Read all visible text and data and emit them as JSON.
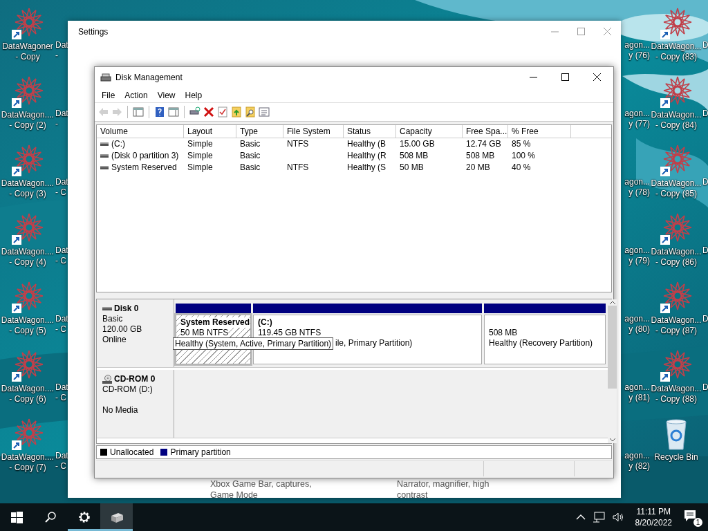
{
  "desktop": {
    "columns": [
      {
        "kind": "full",
        "items": [
          {
            "kind": "shortcut",
            "label": "DataWagoner",
            "sublabel": "- Copy"
          },
          {
            "kind": "shortcut",
            "label": "DataWagon....",
            "sublabel": "- Copy (2)"
          },
          {
            "kind": "shortcut",
            "label": "DataWagon....",
            "sublabel": "- Copy (3)"
          },
          {
            "kind": "shortcut",
            "label": "DataWagon....",
            "sublabel": "- Copy (4)"
          },
          {
            "kind": "shortcut",
            "label": "DataWagon....",
            "sublabel": "- Copy (5)"
          },
          {
            "kind": "shortcut",
            "label": "DataWagon....",
            "sublabel": "- Copy (6)"
          },
          {
            "kind": "shortcut",
            "label": "DataWagon....",
            "sublabel": "- Copy (7)"
          }
        ]
      },
      {
        "kind": "clip-left",
        "items": [
          {
            "label": "Dat",
            "sublabel": "-"
          },
          {
            "label": "Dat",
            "sublabel": "-"
          },
          {
            "label": "Dat",
            "sublabel": "- C"
          },
          {
            "label": "Dat",
            "sublabel": "- C"
          },
          {
            "label": "Dat",
            "sublabel": "- C"
          },
          {
            "label": "Dat",
            "sublabel": "- C"
          },
          {
            "label": "Dat",
            "sublabel": "- C"
          }
        ]
      },
      {
        "kind": "clip-right",
        "items": [
          {
            "label": "agon...",
            "sublabel": "y (76)"
          },
          {
            "label": "agon...",
            "sublabel": "y (77)"
          },
          {
            "label": "agon...",
            "sublabel": "y (78)"
          },
          {
            "label": "agon...",
            "sublabel": "y (79)"
          },
          {
            "label": "agon...",
            "sublabel": "y (80)"
          },
          {
            "label": "agon...",
            "sublabel": "y (81)"
          },
          {
            "label": "agon...",
            "sublabel": "y (82)"
          }
        ]
      },
      {
        "kind": "full",
        "items": [
          {
            "kind": "shortcut",
            "label": "DataWagon...",
            "sublabel": "- Copy (83)"
          },
          {
            "kind": "shortcut",
            "label": "DataWagon...",
            "sublabel": "- Copy (84)"
          },
          {
            "kind": "shortcut",
            "label": "DataWagon...",
            "sublabel": "- Copy (85)"
          },
          {
            "kind": "shortcut",
            "label": "DataWagon...",
            "sublabel": "- Copy (86)"
          },
          {
            "kind": "shortcut",
            "label": "DataWagon...",
            "sublabel": "- Copy (87)"
          },
          {
            "kind": "shortcut",
            "label": "DataWagon...",
            "sublabel": "- Copy (88)"
          },
          {
            "kind": "recycle-bin",
            "label": "Recycle Bin"
          }
        ]
      },
      {
        "kind": "clip-left",
        "items": [
          {
            "label": "D"
          },
          {
            "label": "D"
          },
          {
            "label": "D"
          },
          {
            "label": "D"
          },
          {
            "label": "D"
          },
          {
            "label": "D"
          }
        ]
      }
    ]
  },
  "settings_window": {
    "title": "Settings",
    "items": [
      {
        "text": "Xbox Game Bar, captures, Game Mode"
      },
      {
        "text": "Narrator, magnifier, high contrast"
      }
    ]
  },
  "disk_management": {
    "title": "Disk Management",
    "menu": [
      "File",
      "Action",
      "View",
      "Help"
    ],
    "toolbar": [
      {
        "kind": "back",
        "disabled": true
      },
      {
        "kind": "forward",
        "disabled": true
      },
      {
        "kind": "separator"
      },
      {
        "kind": "console-tree",
        "disabled": false
      },
      {
        "kind": "separator"
      },
      {
        "kind": "help",
        "disabled": false
      },
      {
        "kind": "action-pane",
        "disabled": false
      },
      {
        "kind": "separator"
      },
      {
        "kind": "connect",
        "disabled": false
      },
      {
        "kind": "delete",
        "disabled": false
      },
      {
        "kind": "properties",
        "disabled": false
      },
      {
        "kind": "folder",
        "disabled": false
      },
      {
        "kind": "find",
        "disabled": false
      },
      {
        "kind": "list",
        "disabled": false
      }
    ],
    "volumes": {
      "columns": [
        "Volume",
        "Layout",
        "Type",
        "File System",
        "Status",
        "Capacity",
        "Free Spa...",
        "% Free"
      ],
      "rows": [
        {
          "cells": [
            "(C:)",
            "Simple",
            "Basic",
            "NTFS",
            "Healthy (B",
            "15.00 GB",
            "12.74 GB",
            "85 %"
          ]
        },
        {
          "cells": [
            "(Disk 0 partition 3)",
            "Simple",
            "Basic",
            "",
            "Healthy (R",
            "508 MB",
            "508 MB",
            "100 %"
          ]
        },
        {
          "cells": [
            "System Reserved",
            "Simple",
            "Basic",
            "NTFS",
            "Healthy (S",
            "50 MB",
            "20 MB",
            "40 %"
          ]
        }
      ]
    },
    "disks": [
      {
        "kind": "disk",
        "name": "Disk 0",
        "lines": [
          "Basic",
          "120.00 GB",
          "Online"
        ],
        "partitions": [
          {
            "title": "System Reserved",
            "selected": true,
            "lines": [
              {
                "kind": "plain",
                "text": "50 MB NTFS"
              }
            ]
          },
          {
            "title": "(C:)",
            "selected": false,
            "lines": [
              {
                "kind": "plain",
                "text": "119.45 GB NTFS"
              },
              {
                "kind": "continued",
                "text": "ile, Primary Partition)"
              }
            ]
          },
          {
            "selected": false,
            "lines": [
              {
                "kind": "plain",
                "text": "508 MB"
              },
              {
                "kind": "plain",
                "text": "Healthy (Recovery Partition)"
              }
            ]
          }
        ]
      },
      {
        "kind": "cdrom",
        "name": "CD-ROM 0",
        "lines": [
          "CD-ROM (D:)"
        ],
        "status": "No Media"
      }
    ],
    "tooltip": "Healthy (System, Active, Primary Partition)",
    "legend": [
      {
        "label": "Unallocated",
        "color": "#000000"
      },
      {
        "label": "Primary partition",
        "color": "#000080"
      }
    ]
  },
  "taskbar": {
    "apps": [
      {
        "kind": "start",
        "running": false,
        "selected": false
      },
      {
        "kind": "search",
        "running": false,
        "selected": false
      },
      {
        "kind": "settings",
        "running": true,
        "selected": false
      },
      {
        "kind": "disk-management",
        "running": true,
        "selected": true
      }
    ],
    "time": "11:11 PM",
    "date": "8/20/2022",
    "notifications": "1"
  }
}
